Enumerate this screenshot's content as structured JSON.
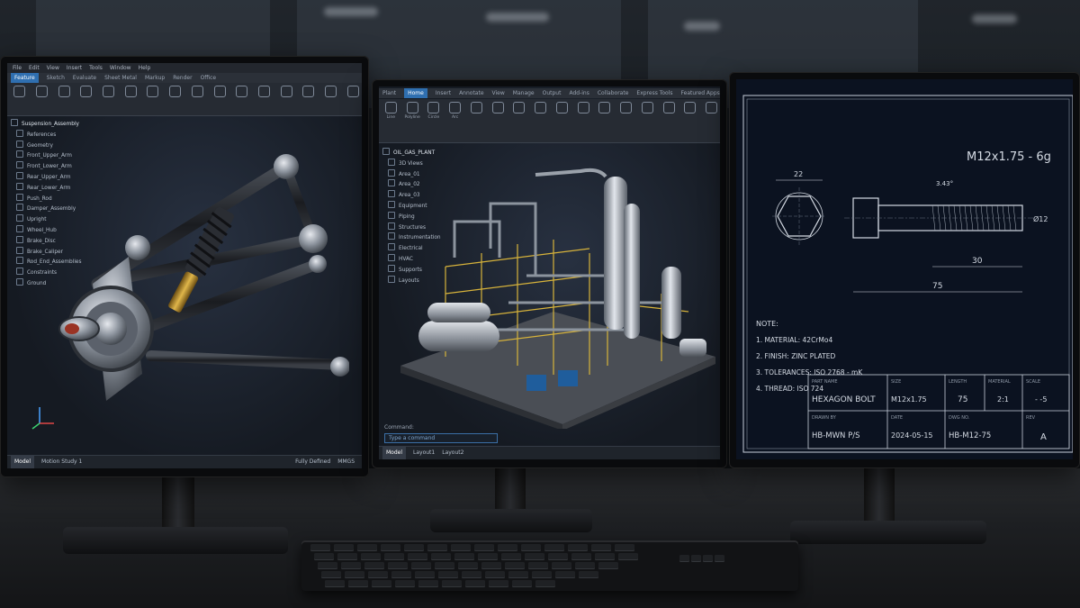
{
  "left_monitor": {
    "menu": [
      "File",
      "Edit",
      "View",
      "Insert",
      "Tools",
      "Window",
      "Help"
    ],
    "tabs": [
      "Feature",
      "Sketch",
      "Evaluate",
      "Sheet Metal",
      "Markup",
      "Render",
      "Office"
    ],
    "active_tab": "Feature",
    "tree_root": "Suspension_Assembly",
    "tree_items": [
      "References",
      "Geometry",
      "Front_Upper_Arm",
      "Front_Lower_Arm",
      "Rear_Upper_Arm",
      "Rear_Lower_Arm",
      "Push_Rod",
      "Damper_Assembly",
      "Upright",
      "Wheel_Hub",
      "Brake_Disc",
      "Brake_Caliper",
      "Rod_End_Assemblies",
      "Constraints",
      "Ground"
    ],
    "status_tabs": [
      "Model",
      "Motion Study 1"
    ],
    "status_left": "Model",
    "status_state": "Fully Defined",
    "status_units": "MMGS"
  },
  "middle_monitor": {
    "tabs": [
      "Plant",
      "Home",
      "Insert",
      "Annotate",
      "View",
      "Manage",
      "Output",
      "Add-ins",
      "Collaborate",
      "Express Tools",
      "Featured Apps"
    ],
    "active_tab": "Home",
    "ribbon_buttons": [
      "Line",
      "Polyline",
      "Circle",
      "Arc"
    ],
    "tree_root": "OIL_GAS_PLANT",
    "tree_items": [
      "3D Views",
      "Area_01",
      "Area_02",
      "Area_03",
      "Equipment",
      "Piping",
      "Structures",
      "Instrumentation",
      "Electrical",
      "HVAC",
      "Supports",
      "Layouts"
    ],
    "command_label": "Command:",
    "command_placeholder": "Type a command",
    "layout_tabs": [
      "Model",
      "Layout1",
      "Layout2"
    ]
  },
  "right_monitor": {
    "title": "M12x1.75 - 6g",
    "dims": {
      "head": "22",
      "thread_len": "30",
      "total": "75",
      "angle": "3.43°",
      "dia": "Ø12"
    },
    "notes_title": "NOTE:",
    "notes": [
      "1. MATERIAL: 42CrMo4",
      "2. FINISH: ZINC PLATED",
      "3. TOLERANCES: ISO 2768 - mK",
      "4. THREAD: ISO 724"
    ],
    "title_block": {
      "part_name_label": "PART NAME",
      "part_name": "HEXAGON BOLT",
      "size_label": "SIZE",
      "size": "M12x1.75",
      "length_label": "LENGTH",
      "length": "75",
      "material_label": "MATERIAL",
      "material": "2:1",
      "scale_label": "SCALE",
      "scale": "- -5",
      "drawn_label": "DRAWN BY",
      "drawn": "HB-MWN P/S",
      "date_label": "DATE",
      "date": "2024-05-15",
      "dwg_label": "DWG NO.",
      "dwg": "HB-M12-75",
      "rev_label": "REV",
      "rev": "A"
    }
  }
}
